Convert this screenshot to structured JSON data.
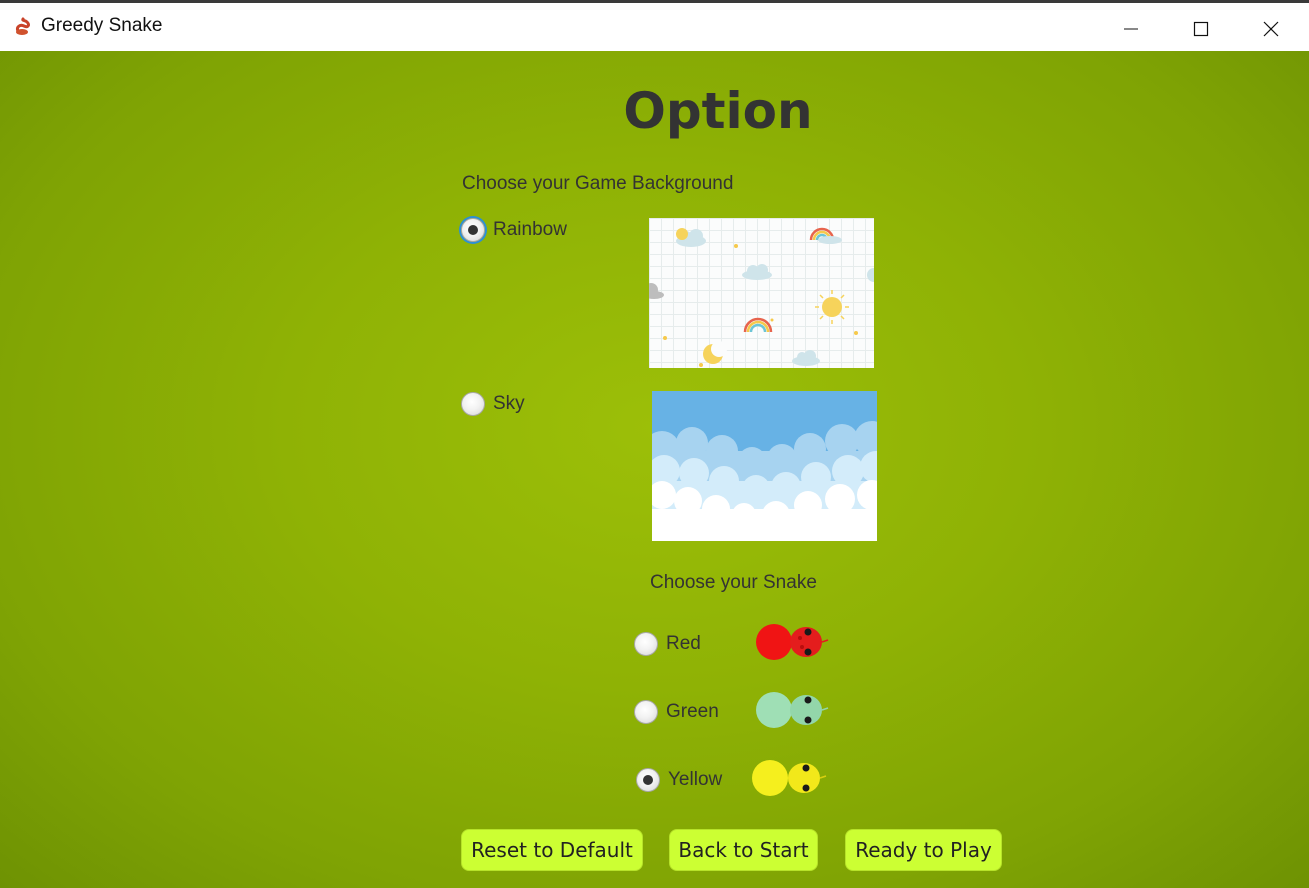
{
  "window": {
    "title": "Greedy Snake",
    "app_icon": "snake-icon",
    "controls": [
      "minimize-icon",
      "maximize-icon",
      "close-icon"
    ]
  },
  "page": {
    "title": "Option"
  },
  "background_section": {
    "label": "Choose your Game Background",
    "options": [
      {
        "label": "Rainbow",
        "checked": true,
        "preview": "rainbow-background-thumbnail"
      },
      {
        "label": "Sky",
        "checked": false,
        "preview": "sky-background-thumbnail"
      }
    ]
  },
  "snake_section": {
    "label": "Choose your Snake",
    "options": [
      {
        "label": "Red",
        "checked": false,
        "color": "#f01414"
      },
      {
        "label": "Green",
        "checked": false,
        "color": "#9fdfb5"
      },
      {
        "label": "Yellow",
        "checked": true,
        "color": "#f5ef1e"
      }
    ]
  },
  "buttons": {
    "reset": "Reset to Default",
    "back": "Back to Start",
    "ready": "Ready to Play"
  },
  "colors": {
    "background_green": "#8fb205",
    "button_fill": "#ccff33",
    "focus_ring": "#2d8fd6",
    "title_text": "#333333"
  }
}
